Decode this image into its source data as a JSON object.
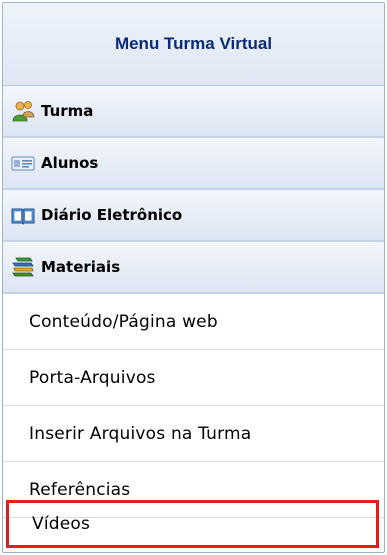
{
  "menu": {
    "title": "Menu Turma Virtual",
    "sections": [
      {
        "label": "Turma",
        "icon": "group-users-icon"
      },
      {
        "label": "Alunos",
        "icon": "id-card-icon"
      },
      {
        "label": "Diário Eletrônico",
        "icon": "open-book-icon"
      },
      {
        "label": "Materiais",
        "icon": "books-stack-icon"
      }
    ],
    "materials": [
      {
        "label": "Conteúdo/Página web"
      },
      {
        "label": "Porta-Arquivos"
      },
      {
        "label": "Inserir Arquivos na Turma"
      },
      {
        "label": "Referências"
      },
      {
        "label": "Vídeos"
      }
    ],
    "highlight_color": "#e31c1c"
  }
}
